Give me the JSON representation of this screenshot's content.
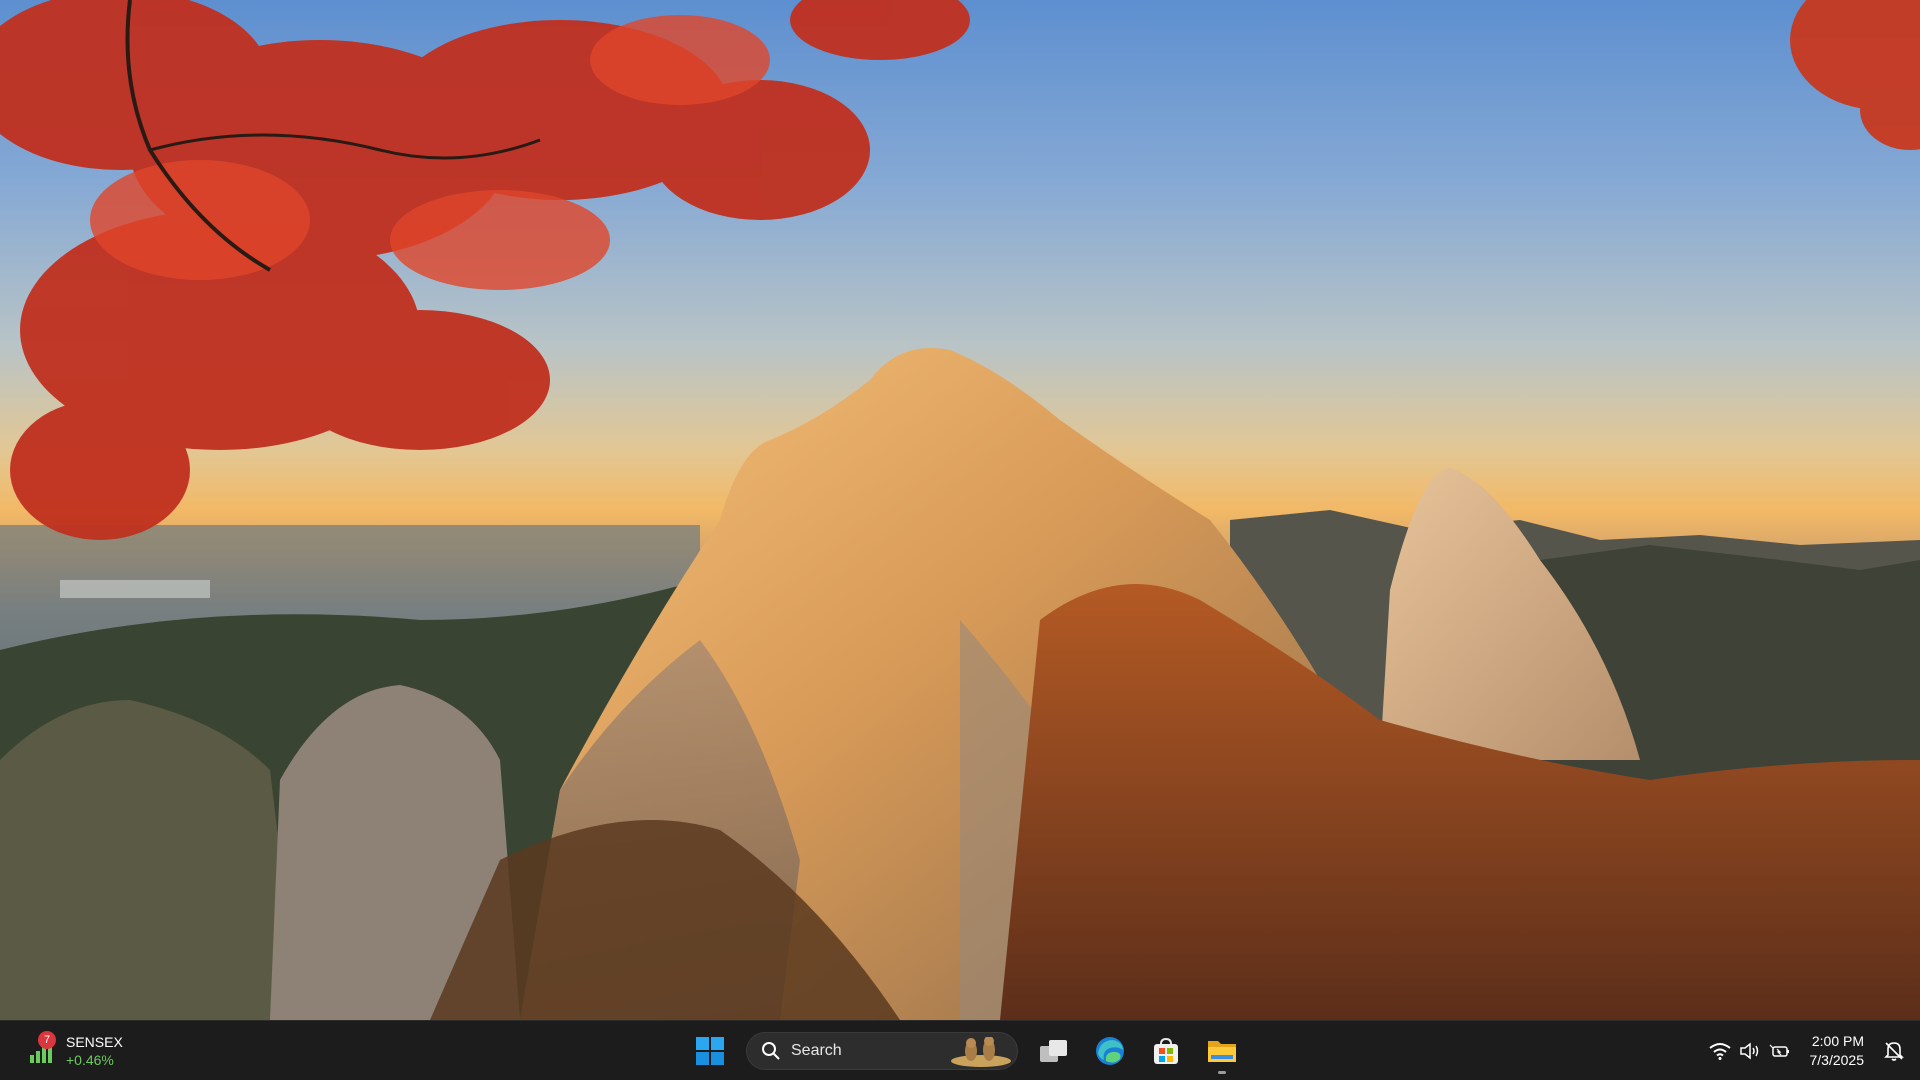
{
  "desktop": {
    "wallpaper": "mountain-autumn-wallpaper"
  },
  "taskbar": {
    "widget": {
      "badge": "7",
      "title": "SENSEX",
      "value": "+0.46%",
      "value_color": "#6ccb5f"
    },
    "start_icon": "windows-start-icon",
    "search": {
      "label": "Search"
    },
    "apps": [
      {
        "name": "task-view",
        "icon": "task-view-icon"
      },
      {
        "name": "edge",
        "icon": "edge-icon"
      },
      {
        "name": "store",
        "icon": "microsoft-store-icon"
      },
      {
        "name": "file-explorer",
        "icon": "file-explorer-icon",
        "running": true
      }
    ],
    "tray": {
      "icons": [
        "wifi-icon",
        "volume-icon",
        "battery-icon"
      ]
    },
    "clock": {
      "time": "2:00 PM",
      "date": "7/3/2025"
    },
    "accent_color": "#0078d4"
  }
}
